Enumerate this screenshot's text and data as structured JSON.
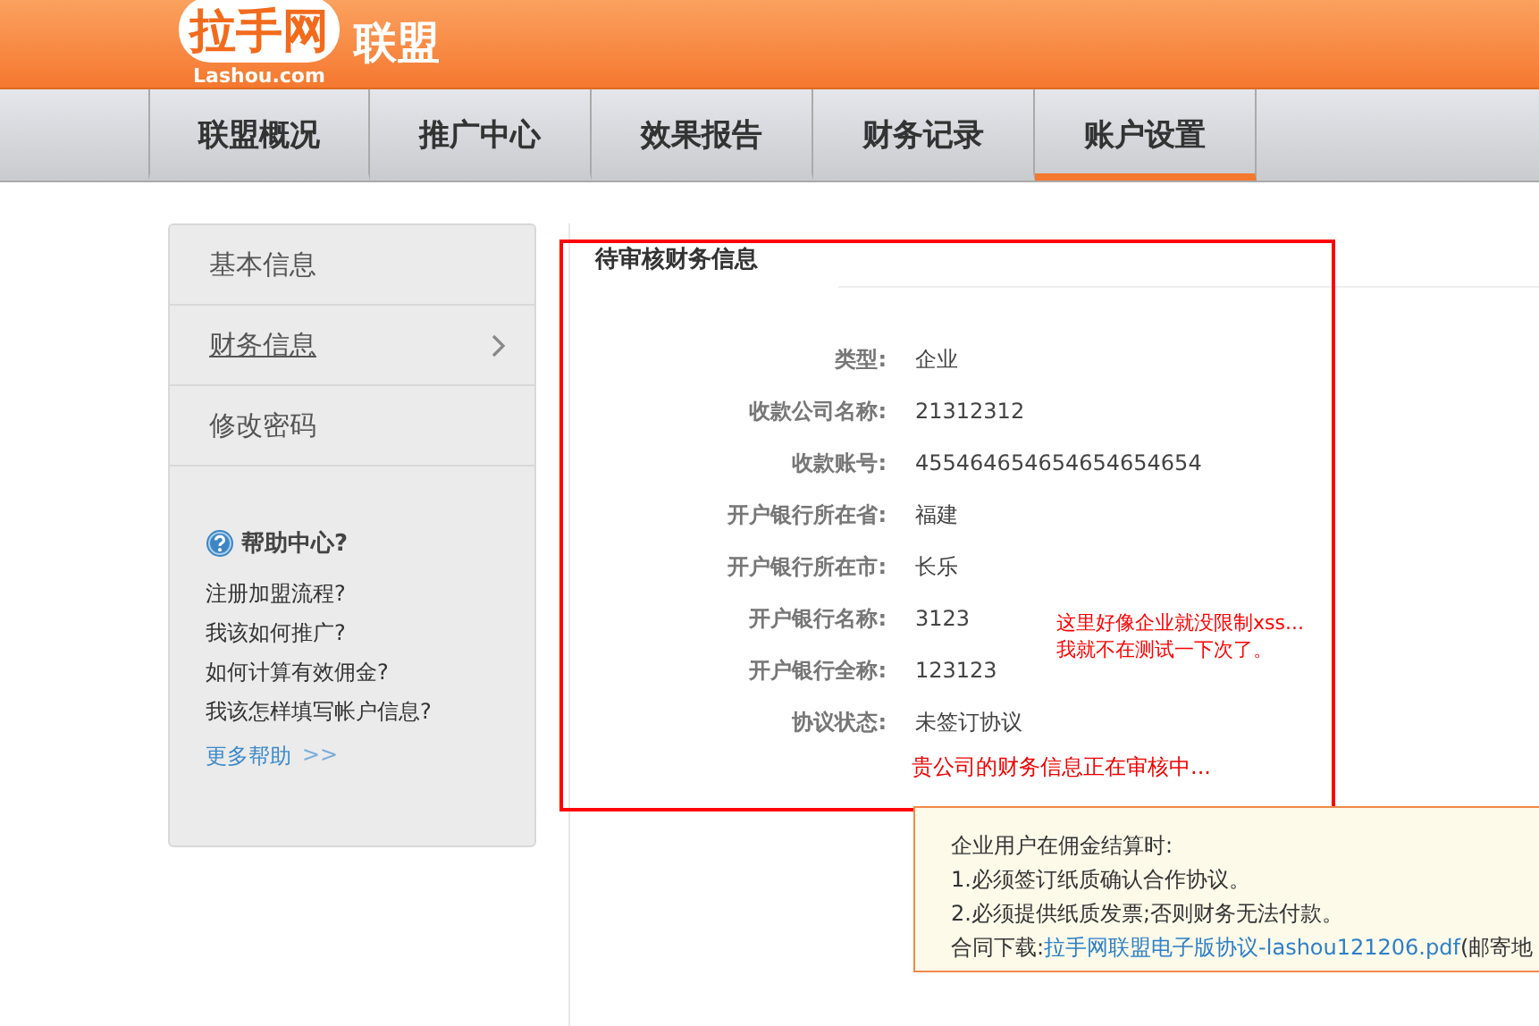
{
  "header": {
    "logo_text": "拉手网",
    "logo_domain": "Lashou.com",
    "brand_suffix": "联盟"
  },
  "nav_tabs": [
    {
      "label": "联盟概况",
      "selected": false
    },
    {
      "label": "推广中心",
      "selected": false
    },
    {
      "label": "效果报告",
      "selected": false
    },
    {
      "label": "财务记录",
      "selected": false
    },
    {
      "label": "账户设置",
      "selected": true
    }
  ],
  "sidebar": {
    "items": [
      {
        "label": "基本信息",
        "selected": false
      },
      {
        "label": "财务信息",
        "selected": true
      },
      {
        "label": "修改密码",
        "selected": false
      }
    ],
    "help": {
      "title": "帮助中心?",
      "links": [
        "注册加盟流程?",
        "我该如何推广?",
        "如何计算有效佣金?",
        "我该怎样填写帐户信息?"
      ],
      "more": "更多帮助",
      "more_arrow": ">>"
    }
  },
  "panel": {
    "tab": "待审核财务信息",
    "fields": [
      {
        "label": "类型:",
        "value": "企业"
      },
      {
        "label": "收款公司名称:",
        "value": "21312312"
      },
      {
        "label": "收款账号:",
        "value": "455464654654654654654"
      },
      {
        "label": "开户银行所在省:",
        "value": "福建"
      },
      {
        "label": "开户银行所在市:",
        "value": "长乐"
      },
      {
        "label": "开户银行名称:",
        "value": "3123"
      },
      {
        "label": "开户银行全称:",
        "value": "123123"
      },
      {
        "label": "协议状态:",
        "value": "未签订协议"
      }
    ],
    "status": "贵公司的财务信息正在审核中...",
    "annotation": [
      "这里好像企业就没限制xss...",
      "我就不在测试一下次了。"
    ]
  },
  "notice": {
    "lines": [
      "企业用户在佣金结算时:",
      "1.必须签订纸质确认合作协议。",
      "2.必须提供纸质发票;否则财务无法付款。"
    ],
    "download_label": "合同下载:",
    "download_link": "拉手网联盟电子版协议-lashou121206.pdf",
    "download_tail": "(邮寄地"
  }
}
